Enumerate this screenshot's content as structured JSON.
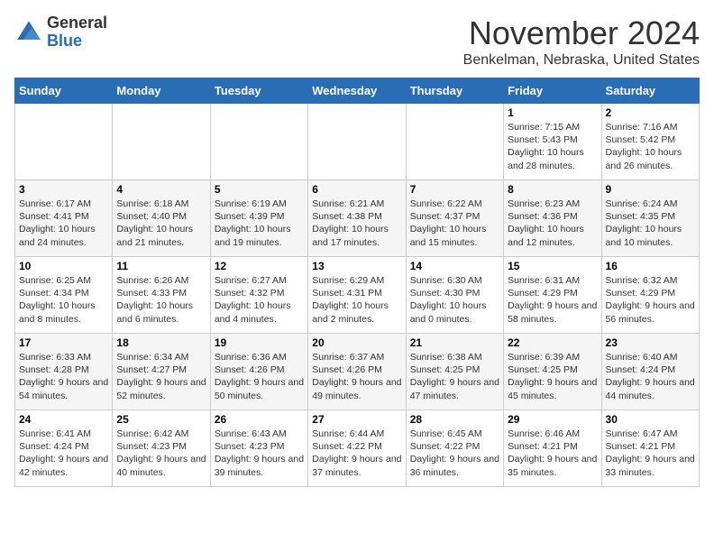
{
  "logo": {
    "general": "General",
    "blue": "Blue"
  },
  "title": "November 2024",
  "location": "Benkelman, Nebraska, United States",
  "days_of_week": [
    "Sunday",
    "Monday",
    "Tuesday",
    "Wednesday",
    "Thursday",
    "Friday",
    "Saturday"
  ],
  "weeks": [
    [
      {
        "day": "",
        "info": ""
      },
      {
        "day": "",
        "info": ""
      },
      {
        "day": "",
        "info": ""
      },
      {
        "day": "",
        "info": ""
      },
      {
        "day": "",
        "info": ""
      },
      {
        "day": "1",
        "info": "Sunrise: 7:15 AM\nSunset: 5:43 PM\nDaylight: 10 hours\nand 28 minutes."
      },
      {
        "day": "2",
        "info": "Sunrise: 7:16 AM\nSunset: 5:42 PM\nDaylight: 10 hours\nand 26 minutes."
      }
    ],
    [
      {
        "day": "3",
        "info": "Sunrise: 6:17 AM\nSunset: 4:41 PM\nDaylight: 10 hours\nand 24 minutes."
      },
      {
        "day": "4",
        "info": "Sunrise: 6:18 AM\nSunset: 4:40 PM\nDaylight: 10 hours\nand 21 minutes."
      },
      {
        "day": "5",
        "info": "Sunrise: 6:19 AM\nSunset: 4:39 PM\nDaylight: 10 hours\nand 19 minutes."
      },
      {
        "day": "6",
        "info": "Sunrise: 6:21 AM\nSunset: 4:38 PM\nDaylight: 10 hours\nand 17 minutes."
      },
      {
        "day": "7",
        "info": "Sunrise: 6:22 AM\nSunset: 4:37 PM\nDaylight: 10 hours\nand 15 minutes."
      },
      {
        "day": "8",
        "info": "Sunrise: 6:23 AM\nSunset: 4:36 PM\nDaylight: 10 hours\nand 12 minutes."
      },
      {
        "day": "9",
        "info": "Sunrise: 6:24 AM\nSunset: 4:35 PM\nDaylight: 10 hours\nand 10 minutes."
      }
    ],
    [
      {
        "day": "10",
        "info": "Sunrise: 6:25 AM\nSunset: 4:34 PM\nDaylight: 10 hours\nand 8 minutes."
      },
      {
        "day": "11",
        "info": "Sunrise: 6:26 AM\nSunset: 4:33 PM\nDaylight: 10 hours\nand 6 minutes."
      },
      {
        "day": "12",
        "info": "Sunrise: 6:27 AM\nSunset: 4:32 PM\nDaylight: 10 hours\nand 4 minutes."
      },
      {
        "day": "13",
        "info": "Sunrise: 6:29 AM\nSunset: 4:31 PM\nDaylight: 10 hours\nand 2 minutes."
      },
      {
        "day": "14",
        "info": "Sunrise: 6:30 AM\nSunset: 4:30 PM\nDaylight: 10 hours\nand 0 minutes."
      },
      {
        "day": "15",
        "info": "Sunrise: 6:31 AM\nSunset: 4:29 PM\nDaylight: 9 hours\nand 58 minutes."
      },
      {
        "day": "16",
        "info": "Sunrise: 6:32 AM\nSunset: 4:29 PM\nDaylight: 9 hours\nand 56 minutes."
      }
    ],
    [
      {
        "day": "17",
        "info": "Sunrise: 6:33 AM\nSunset: 4:28 PM\nDaylight: 9 hours\nand 54 minutes."
      },
      {
        "day": "18",
        "info": "Sunrise: 6:34 AM\nSunset: 4:27 PM\nDaylight: 9 hours\nand 52 minutes."
      },
      {
        "day": "19",
        "info": "Sunrise: 6:36 AM\nSunset: 4:26 PM\nDaylight: 9 hours\nand 50 minutes."
      },
      {
        "day": "20",
        "info": "Sunrise: 6:37 AM\nSunset: 4:26 PM\nDaylight: 9 hours\nand 49 minutes."
      },
      {
        "day": "21",
        "info": "Sunrise: 6:38 AM\nSunset: 4:25 PM\nDaylight: 9 hours\nand 47 minutes."
      },
      {
        "day": "22",
        "info": "Sunrise: 6:39 AM\nSunset: 4:25 PM\nDaylight: 9 hours\nand 45 minutes."
      },
      {
        "day": "23",
        "info": "Sunrise: 6:40 AM\nSunset: 4:24 PM\nDaylight: 9 hours\nand 44 minutes."
      }
    ],
    [
      {
        "day": "24",
        "info": "Sunrise: 6:41 AM\nSunset: 4:24 PM\nDaylight: 9 hours\nand 42 minutes."
      },
      {
        "day": "25",
        "info": "Sunrise: 6:42 AM\nSunset: 4:23 PM\nDaylight: 9 hours\nand 40 minutes."
      },
      {
        "day": "26",
        "info": "Sunrise: 6:43 AM\nSunset: 4:23 PM\nDaylight: 9 hours\nand 39 minutes."
      },
      {
        "day": "27",
        "info": "Sunrise: 6:44 AM\nSunset: 4:22 PM\nDaylight: 9 hours\nand 37 minutes."
      },
      {
        "day": "28",
        "info": "Sunrise: 6:45 AM\nSunset: 4:22 PM\nDaylight: 9 hours\nand 36 minutes."
      },
      {
        "day": "29",
        "info": "Sunrise: 6:46 AM\nSunset: 4:21 PM\nDaylight: 9 hours\nand 35 minutes."
      },
      {
        "day": "30",
        "info": "Sunrise: 6:47 AM\nSunset: 4:21 PM\nDaylight: 9 hours\nand 33 minutes."
      }
    ]
  ]
}
